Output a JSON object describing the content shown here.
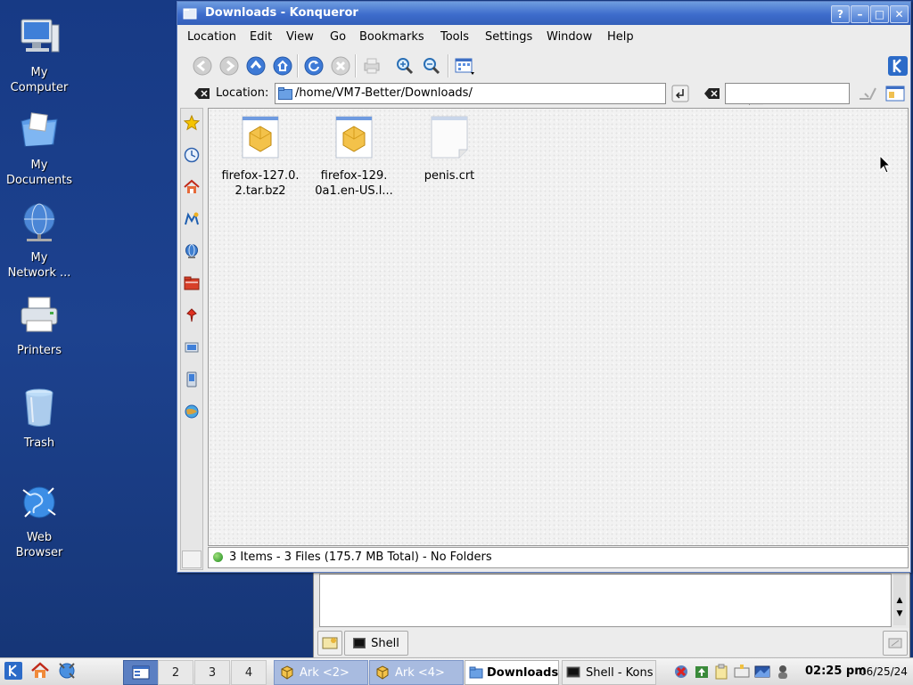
{
  "desktop": {
    "icons": [
      {
        "label": "My\nComputer"
      },
      {
        "label": "My\nDocuments"
      },
      {
        "label": "My\nNetwork ..."
      },
      {
        "label": "Printers"
      },
      {
        "label": "Trash"
      },
      {
        "label": "Web\nBrowser"
      }
    ]
  },
  "window": {
    "title": "Downloads - Konqueror",
    "buttons": {
      "help": "?",
      "minimize": "–",
      "maximize": "□",
      "close": "✕"
    },
    "menu": [
      "Location",
      "Edit",
      "View",
      "Go",
      "Bookmarks",
      "Tools",
      "Settings",
      "Window",
      "Help"
    ],
    "location_label": "Location:",
    "location_value": "/home/VM7-Better/Downloads/",
    "search_value": "",
    "files": [
      {
        "name": "firefox-127.0.\n2.tar.bz2",
        "icon": "archive-icon"
      },
      {
        "name": "firefox-129.\n0a1.en-US.l...",
        "icon": "archive-icon"
      },
      {
        "name": "penis.crt",
        "icon": "document-icon"
      }
    ],
    "status_text": "3 Items - 3 Files (175.7 MB Total) - No Folders"
  },
  "konsole": {
    "tab_label": "Shell"
  },
  "taskbar": {
    "pager": [
      "1",
      "2",
      "3",
      "4"
    ],
    "tasks": [
      {
        "label": "Ark <2>"
      },
      {
        "label": "Ark <4>"
      },
      {
        "label": "Downloads"
      },
      {
        "label": "Shell - Kons"
      }
    ],
    "clock": "02:25 pm",
    "date": "06/25/24"
  },
  "colors": {
    "desktop": "#1d428f",
    "titlebar": "#3d6ccc",
    "accent": "#5b7fc2"
  }
}
